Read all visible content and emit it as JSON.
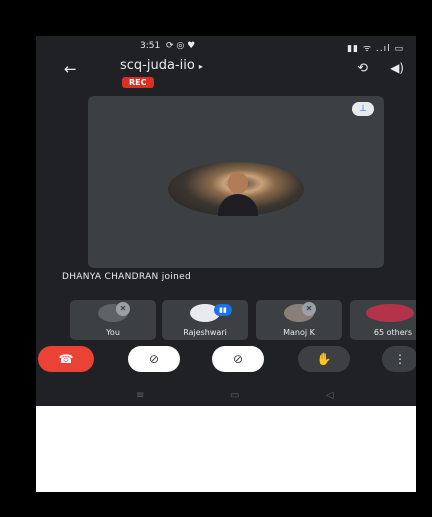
{
  "status_bar": {
    "time": "3:51",
    "icons": "⟳ ◎ ♥",
    "right_icons": "▮▮ ᯤ ..ıl ▭"
  },
  "header": {
    "back_icon": "←",
    "meeting_code": "scq-juda-iio",
    "code_caret": "▸",
    "rec_label": "REC",
    "camera_switch_icon": "⟲",
    "speaker_icon": "◀)"
  },
  "main_tile": {
    "pin_icon": "⊥"
  },
  "notification": {
    "text": "DHANYA CHANDRAN joined"
  },
  "participants": [
    {
      "name": "You"
    },
    {
      "name": "Rajeshwari"
    },
    {
      "name": "Manoj K"
    },
    {
      "name": "65 others"
    }
  ],
  "controls": {
    "end_icon": "☎",
    "camera_icon": "⊘",
    "mic_icon": "⊘",
    "hand_icon": "✋",
    "more_icon": "⋮"
  },
  "navbar": {
    "recents": "≡",
    "home": "▭",
    "back": "◁"
  }
}
